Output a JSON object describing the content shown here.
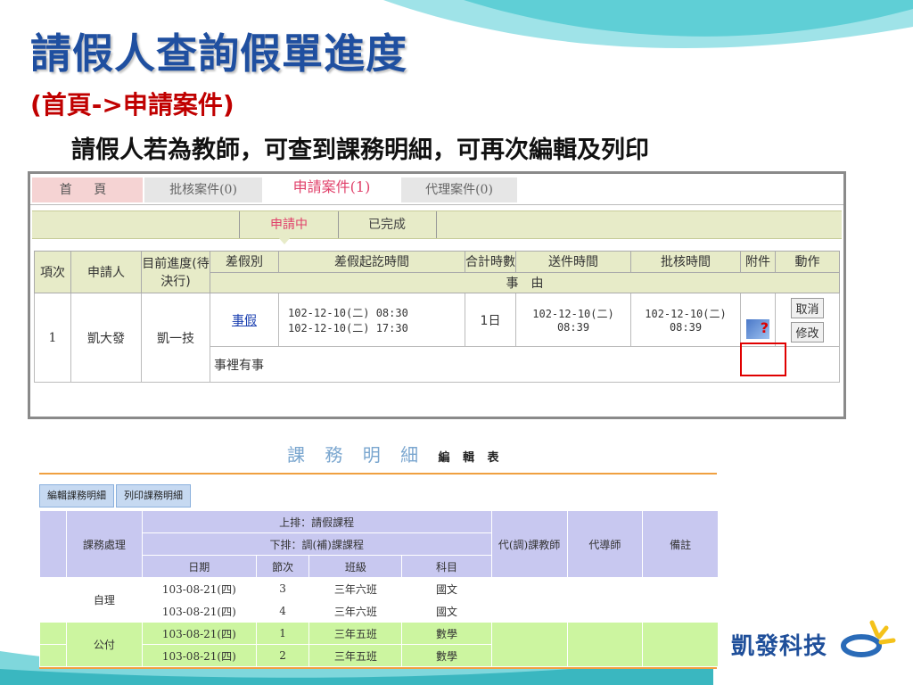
{
  "slide": {
    "title": "請假人查詢假單進度",
    "subtitle": "(首頁->申請案件)",
    "description": "請假人若為教師，可查到課務明細，可再次編輯及列印"
  },
  "tabs": [
    {
      "label": "首 頁"
    },
    {
      "label": "批核案件(0)"
    },
    {
      "label": "申請案件(1)"
    },
    {
      "label": "代理案件(0)"
    }
  ],
  "subtabs": [
    {
      "label": "申請中"
    },
    {
      "label": "已完成"
    }
  ],
  "leave_table": {
    "headers": {
      "index": "項次",
      "applicant": "申請人",
      "progress": "目前進度(待決行)",
      "leave_type": "差假別",
      "period": "差假起訖時間",
      "total_time": "合計時數",
      "submit_time": "送件時間",
      "approve_time": "批核時間",
      "attachment": "附件",
      "action": "動作",
      "reason": "事　由"
    },
    "row": {
      "index": "1",
      "applicant": "凱大發",
      "progress": "凱一技",
      "leave_type": "事假",
      "start": "102-12-10(二) 08:30",
      "end": "102-12-10(二) 17:30",
      "total": "1日",
      "submit_date": "102-12-10(二)",
      "submit_time": "08:39",
      "approve_date": "102-12-10(二)",
      "approve_time": "08:39",
      "cancel_label": "取消",
      "edit_label": "修改",
      "reason": "事裡有事"
    }
  },
  "course_detail": {
    "title": "課 務 明 細",
    "title_suffix": "編 輯 表",
    "buttons": {
      "edit": "編輯課務明細",
      "print": "列印課務明細"
    },
    "headers": {
      "handling": "課務處理",
      "upper": "上排：請假課程",
      "lower": "下排：調(補)課課程",
      "date": "日期",
      "period": "節次",
      "class": "班級",
      "subject": "科目",
      "count": "代(調)課教師",
      "substitute": "代導師",
      "note": "備註"
    },
    "rows": [
      {
        "handling": "自理",
        "date": "103-08-21(四)",
        "period": "3",
        "class": "三年六班",
        "subject": "國文"
      },
      {
        "handling": "",
        "date": "103-08-21(四)",
        "period": "4",
        "class": "三年六班",
        "subject": "國文"
      },
      {
        "handling": "公付",
        "date": "103-08-21(四)",
        "period": "1",
        "class": "三年五班",
        "subject": "數學"
      },
      {
        "handling": "",
        "date": "103-08-21(四)",
        "period": "2",
        "class": "三年五班",
        "subject": "數學"
      }
    ]
  },
  "logo": {
    "text": "凱發科技"
  },
  "colors": {
    "title": "#1f4fa0",
    "subtitle": "#c00000",
    "accent_pink": "#e0406a",
    "olive_header": "#e7ebc8",
    "green_row": "#ccf5a0",
    "lavender_header": "#c8c8f0"
  }
}
